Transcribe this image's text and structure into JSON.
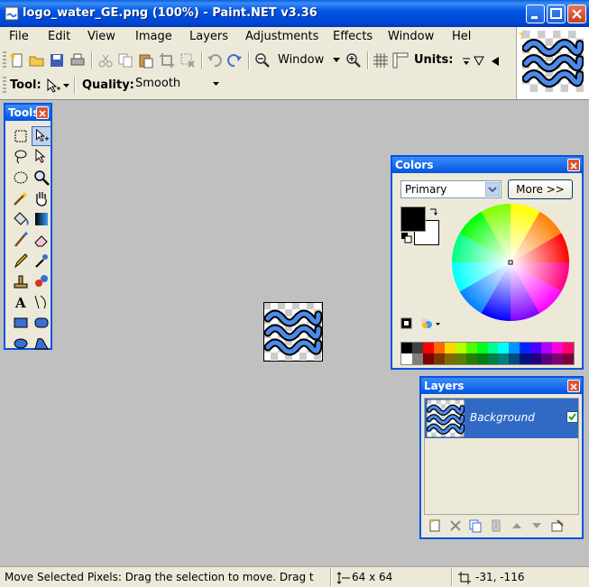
{
  "window": {
    "title": "logo_water_GE.png (100%) - Paint.NET v3.36"
  },
  "menu": [
    "File",
    "Edit",
    "View",
    "Image",
    "Layers",
    "Adjustments",
    "Effects",
    "Window",
    "Hel"
  ],
  "toolbar": {
    "zoom_value": "Window",
    "units_label": "Units:"
  },
  "toolbar2": {
    "tool_label": "Tool:",
    "quality_label": "Quality:",
    "quality_value": "Smooth"
  },
  "tools_window": {
    "title": "Tools"
  },
  "colors_window": {
    "title": "Colors",
    "mode_value": "Primary",
    "more_button": "More >>"
  },
  "layers_window": {
    "title": "Layers",
    "layers": [
      {
        "name": "Background",
        "visible": true
      }
    ]
  },
  "status": {
    "message": "Move Selected Pixels: Drag the selection to move. Drag t",
    "image_size": "64 x 64",
    "cursor_pos": "-31, -116"
  },
  "colors": {
    "accent": "#0054e3",
    "canvas_bg": "#c0c0c0",
    "wave_blue": "#3a78d8"
  }
}
